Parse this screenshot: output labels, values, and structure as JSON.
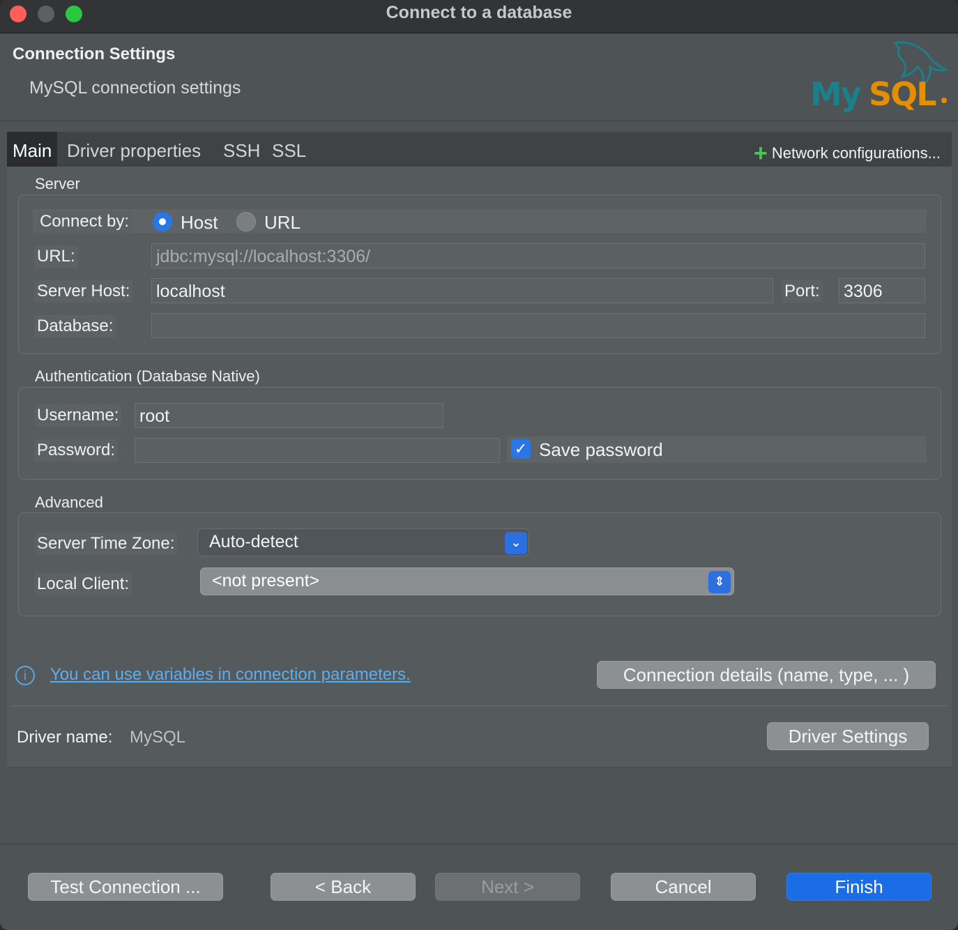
{
  "window": {
    "title": "Connect to a database"
  },
  "header": {
    "title": "Connection Settings",
    "subtitle": "MySQL connection settings",
    "logo_text": "MySQL"
  },
  "tabs": [
    {
      "label": "Main",
      "active": true
    },
    {
      "label": "Driver properties"
    },
    {
      "label": "SSH"
    },
    {
      "label": "SSL"
    }
  ],
  "network_configurations": {
    "label": "Network configurations...",
    "icon": "plus-icon"
  },
  "server": {
    "section_label": "Server",
    "connect_by_label": "Connect by:",
    "option_host": "Host",
    "option_url": "URL",
    "selected": "Host",
    "url_label": "URL:",
    "url_value": "jdbc:mysql://localhost:3306/",
    "host_label": "Server Host:",
    "host_value": "localhost",
    "port_label": "Port:",
    "port_value": "3306",
    "database_label": "Database:",
    "database_value": ""
  },
  "auth": {
    "section_label": "Authentication (Database Native)",
    "username_label": "Username:",
    "username_value": "root",
    "password_label": "Password:",
    "password_value": "",
    "save_password_label": "Save password",
    "save_password_checked": true
  },
  "advanced": {
    "section_label": "Advanced",
    "timezone_label": "Server Time Zone:",
    "timezone_value": "Auto-detect",
    "local_client_label": "Local Client:",
    "local_client_value": "<not present>"
  },
  "info": {
    "link_text": "You can use variables in connection parameters."
  },
  "connection_details_button": "Connection details (name, type, ... )",
  "driver": {
    "label": "Driver name:",
    "value": "MySQL",
    "settings_button": "Driver Settings"
  },
  "footer": {
    "test_connection": "Test Connection ...",
    "back": "< Back",
    "next": "Next >",
    "cancel": "Cancel",
    "finish": "Finish"
  },
  "colors": {
    "accent": "#1b6de6",
    "link": "#5aaef0",
    "plus": "#4fc44f",
    "logo_blue": "#1b7f8c",
    "logo_orange": "#e48e00"
  }
}
